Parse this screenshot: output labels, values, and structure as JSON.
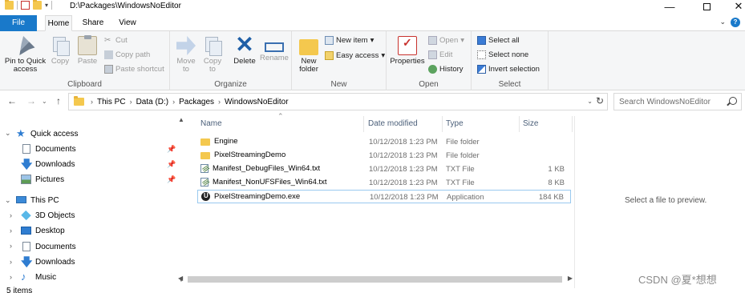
{
  "window": {
    "title_path": "D:\\Packages\\WindowsNoEditor",
    "qat_dropdown": "▾",
    "minimize": "—",
    "close": "✕"
  },
  "tabs": [
    {
      "label": "File"
    },
    {
      "label": "Home"
    },
    {
      "label": "Share"
    },
    {
      "label": "View"
    }
  ],
  "ribbon": {
    "clipboard": {
      "label": "Clipboard",
      "pin_to_quick_access": "Pin to Quick access",
      "copy": "Copy",
      "paste": "Paste",
      "cut": "Cut",
      "copy_path": "Copy path",
      "paste_shortcut": "Paste shortcut"
    },
    "organize": {
      "label": "Organize",
      "move_to": "Move to",
      "copy_to": "Copy to",
      "delete": "Delete",
      "rename": "Rename"
    },
    "new": {
      "label": "New",
      "new_folder": "New folder",
      "new_item": "New item",
      "easy_access": "Easy access"
    },
    "open": {
      "label": "Open",
      "properties": "Properties",
      "open": "Open",
      "edit": "Edit",
      "history": "History"
    },
    "select": {
      "label": "Select",
      "select_all": "Select all",
      "select_none": "Select none",
      "invert_selection": "Invert selection"
    }
  },
  "address": {
    "crumbs": [
      "This PC",
      "Data (D:)",
      "Packages",
      "WindowsNoEditor"
    ],
    "separator": "›",
    "search_placeholder": "Search WindowsNoEditor"
  },
  "nav": {
    "quick_access": "Quick access",
    "quick_items": [
      "Documents",
      "Downloads",
      "Pictures"
    ],
    "this_pc": "This PC",
    "pc_items": [
      "3D Objects",
      "Desktop",
      "Documents",
      "Downloads",
      "Music"
    ]
  },
  "columns": {
    "name": "Name",
    "date_modified": "Date modified",
    "type": "Type",
    "size": "Size"
  },
  "files": [
    {
      "name": "Engine",
      "date": "10/12/2018 1:23 PM",
      "type": "File folder",
      "size": ""
    },
    {
      "name": "PixelStreamingDemo",
      "date": "10/12/2018 1:23 PM",
      "type": "File folder",
      "size": ""
    },
    {
      "name": "Manifest_DebugFiles_Win64.txt",
      "date": "10/12/2018 1:23 PM",
      "type": "TXT File",
      "size": "1 KB"
    },
    {
      "name": "Manifest_NonUFSFiles_Win64.txt",
      "date": "10/12/2018 1:23 PM",
      "type": "TXT File",
      "size": "8 KB"
    },
    {
      "name": "PixelStreamingDemo.exe",
      "date": "10/12/2018 1:23 PM",
      "type": "Application",
      "size": "184 KB"
    }
  ],
  "preview_message": "Select a file to preview.",
  "status": "5 items",
  "watermark": "CSDN @夏*想想"
}
